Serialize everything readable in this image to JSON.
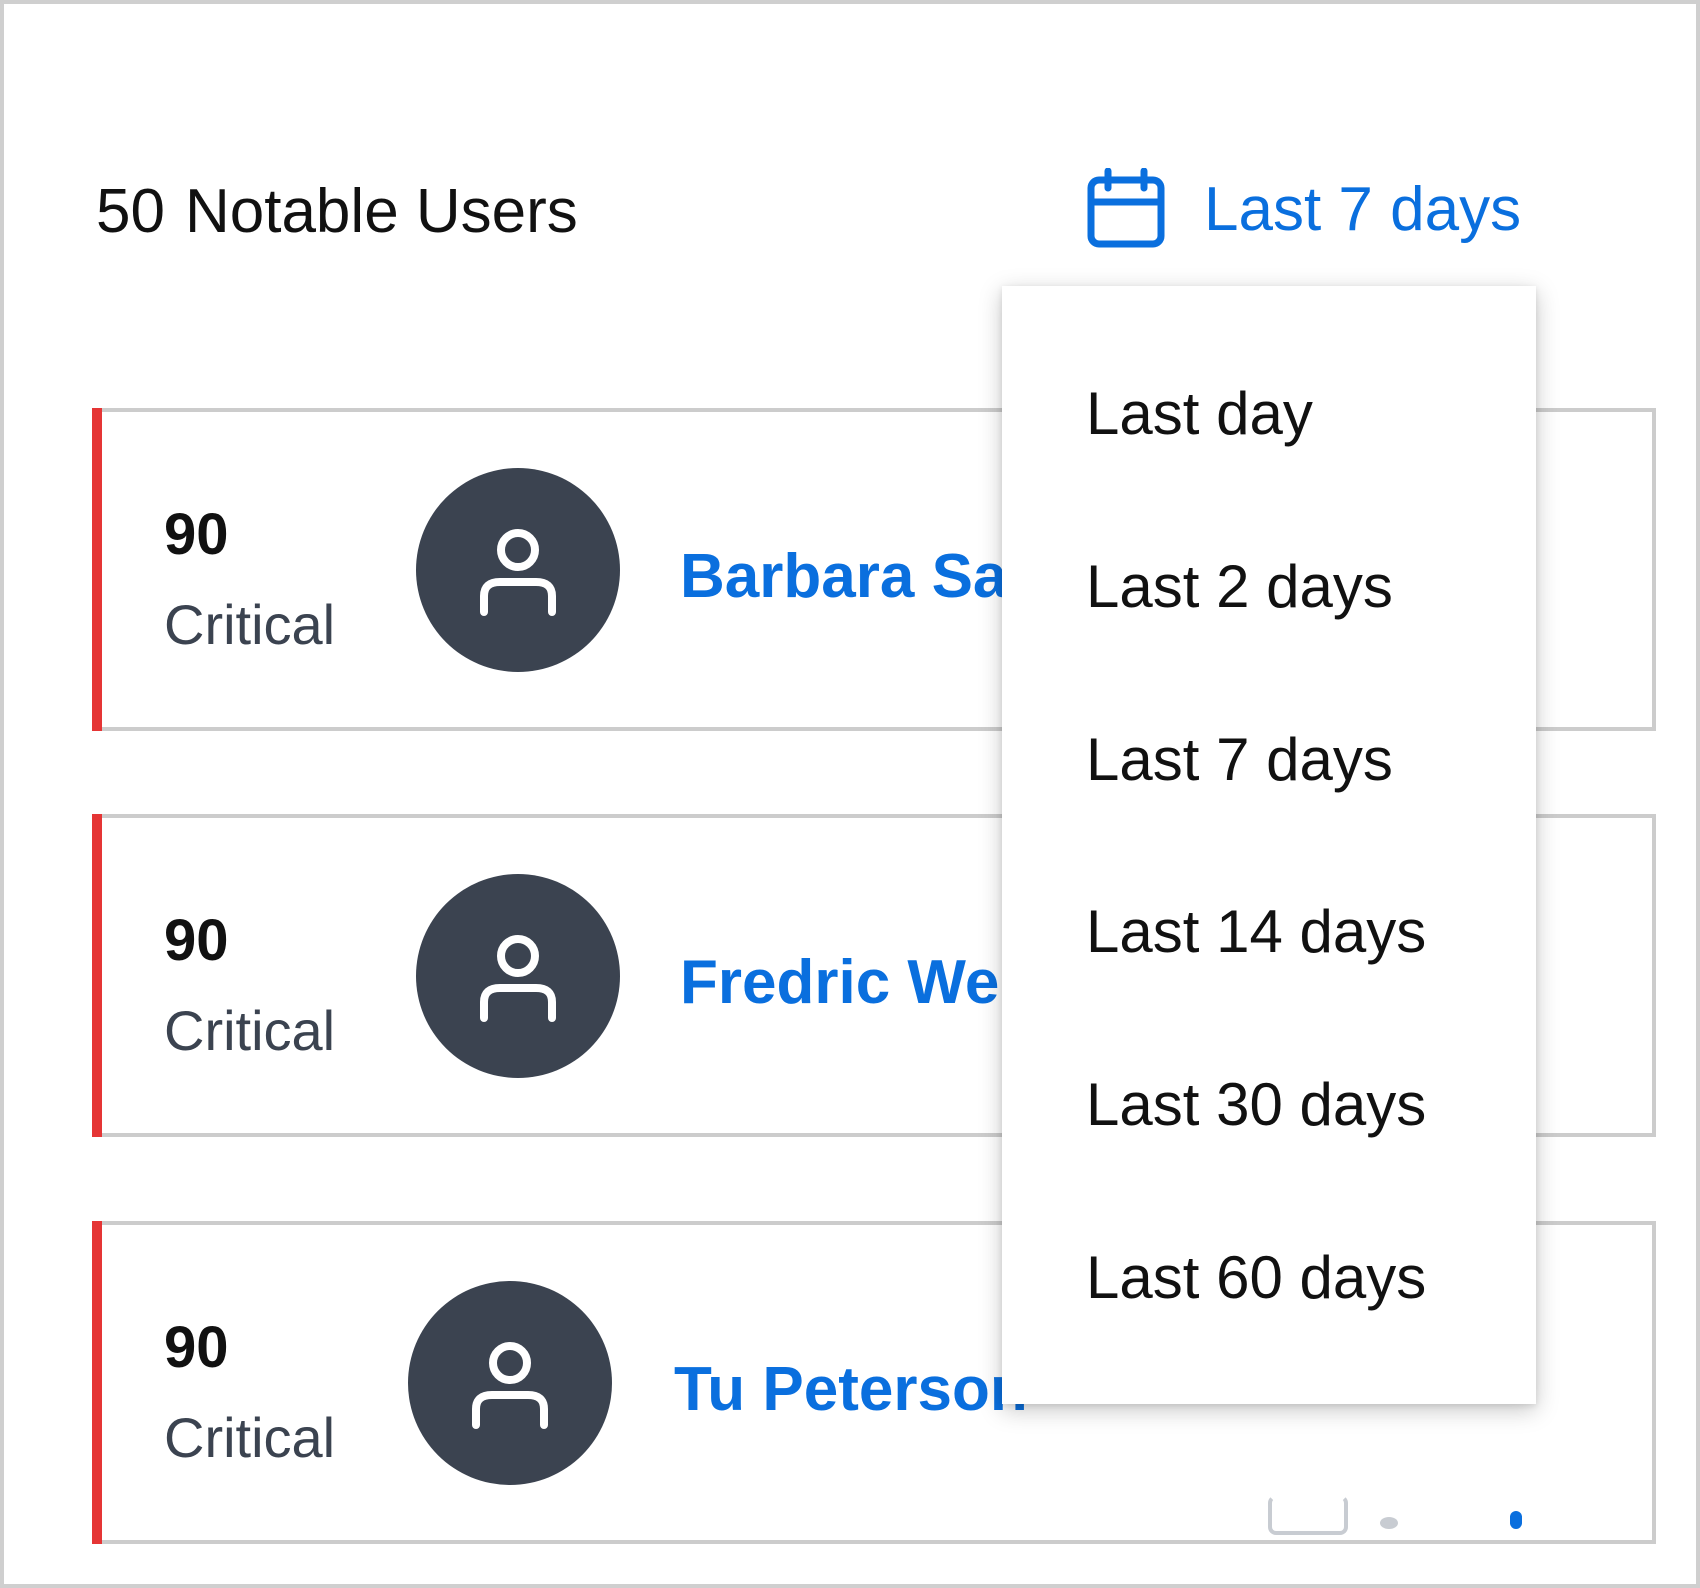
{
  "header": {
    "count": "50",
    "title": "Notable Users",
    "date_range_label": "Last 7 days",
    "date_range_icon": "calendar-icon"
  },
  "accent_color": "#0a6fde",
  "critical_color": "#e53535",
  "users": [
    {
      "score": "90",
      "level": "Critical",
      "name": "Barbara Sa",
      "avatar_icon": "user-icon"
    },
    {
      "score": "90",
      "level": "Critical",
      "name": "Fredric We",
      "avatar_icon": "user-icon"
    },
    {
      "score": "90",
      "level": "Critical",
      "name": "Tu Peterson",
      "avatar_icon": "user-icon"
    }
  ],
  "date_range_menu": {
    "options": [
      "Last day",
      "Last 2 days",
      "Last 7 days",
      "Last 14 days",
      "Last 30 days",
      "Last 60 days"
    ],
    "selected": "Last 7 days"
  }
}
